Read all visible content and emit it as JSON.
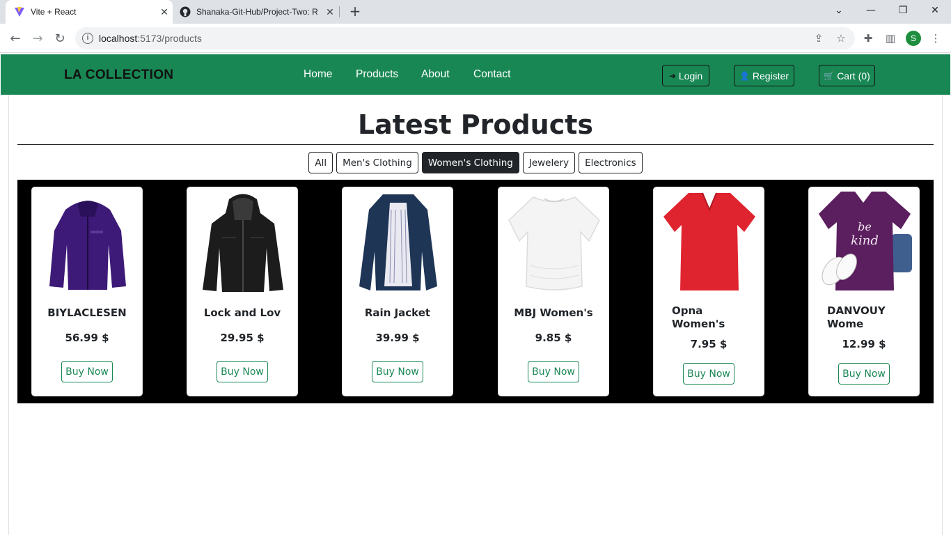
{
  "browser": {
    "tabs": [
      {
        "title": "Vite + React",
        "active": true,
        "icon": "vite-icon"
      },
      {
        "title": "Shanaka-Git-Hub/Project-Two: R",
        "active": false,
        "icon": "github-icon"
      }
    ],
    "url_host": "localhost",
    "url_rest": ":5173/products",
    "profile_initial": "S"
  },
  "navbar": {
    "brand": "LA COLLECTION",
    "links": [
      "Home",
      "Products",
      "About",
      "Contact"
    ],
    "login": "Login",
    "register": "Register",
    "cart": "Cart",
    "cart_count": "(0)",
    "bg_color": "#198754"
  },
  "page": {
    "heading": "Latest Products",
    "filters": [
      {
        "label": "All",
        "active": false
      },
      {
        "label": "Men's Clothing",
        "active": false
      },
      {
        "label": "Women's Clothing",
        "active": true
      },
      {
        "label": "Jewelery",
        "active": false
      },
      {
        "label": "Electronics",
        "active": false
      }
    ]
  },
  "products": [
    {
      "title": "BIYLACLESEN",
      "price": "56.99 $",
      "button": "Buy Now",
      "image": "purple-jacket"
    },
    {
      "title": "Lock and Lov",
      "price": "29.95 $",
      "button": "Buy Now",
      "image": "black-leather-jacket"
    },
    {
      "title": "Rain Jacket",
      "price": "39.99 $",
      "button": "Buy Now",
      "image": "navy-rain-jacket"
    },
    {
      "title": "MBJ Women's",
      "price": "9.85 $",
      "button": "Buy Now",
      "image": "white-top"
    },
    {
      "title_line1": "Opna",
      "title_line2": "Women's",
      "price": "7.95 $",
      "button": "Buy Now",
      "image": "red-tshirt"
    },
    {
      "title_line1": "DANVOUY",
      "title_line2": "Wome",
      "price": "12.99 $",
      "button": "Buy Now",
      "image": "purple-be-kind-tshirt"
    }
  ]
}
